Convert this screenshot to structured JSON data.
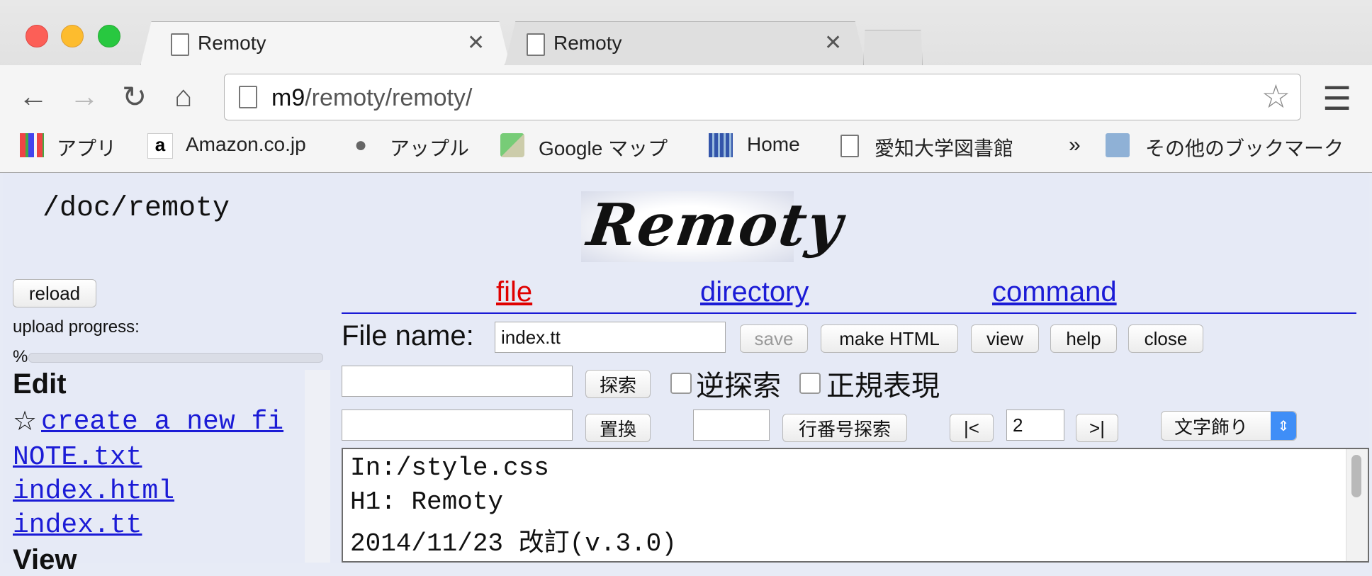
{
  "browser": {
    "tabs": [
      {
        "title": "Remoty"
      },
      {
        "title": "Remoty"
      }
    ],
    "url_host": "m9",
    "url_path": "/remoty/remoty/",
    "bookmarks": [
      "アプリ",
      "Amazon.co.jp",
      "アップル",
      "Google マップ",
      "Home",
      "愛知大学図書館",
      "その他のブックマーク"
    ],
    "bookmarks_overflow": "»"
  },
  "page": {
    "path": "/doc/remoty",
    "logo_text": "Remoty",
    "reload_label": "reload",
    "upload_progress_label": "upload progress:",
    "progress_percent_text": "%",
    "progress": 0,
    "menu": {
      "file": "file",
      "directory": "directory",
      "command": "command"
    },
    "filename_label": "File name:",
    "filename_value": "index.tt",
    "buttons": {
      "save": "save",
      "make_html": "make HTML",
      "view": "view",
      "help": "help",
      "close": "close"
    },
    "search_button": "探索",
    "reverse_search_label": "逆探索",
    "regex_label": "正規表現",
    "replace_button": "置換",
    "line_search_button": "行番号探索",
    "first_button": "|<",
    "line_number_value": "2",
    "next_button": ">|",
    "decoration_select": "文字飾り",
    "sidebar": {
      "edit_heading": "Edit",
      "create_link": "create a new fi",
      "create_prefix": "☆",
      "files": [
        "NOTE.txt",
        "index.html",
        "index.tt"
      ],
      "view_heading": "View"
    },
    "editor_lines": [
      "In:/style.css",
      "H1: Remoty",
      "2014/11/23 改訂(v.3.0)"
    ]
  },
  "colors": {
    "active_menu": "#e00000",
    "link": "#1b1bd6",
    "menu_rule": "#1b1bd6"
  }
}
